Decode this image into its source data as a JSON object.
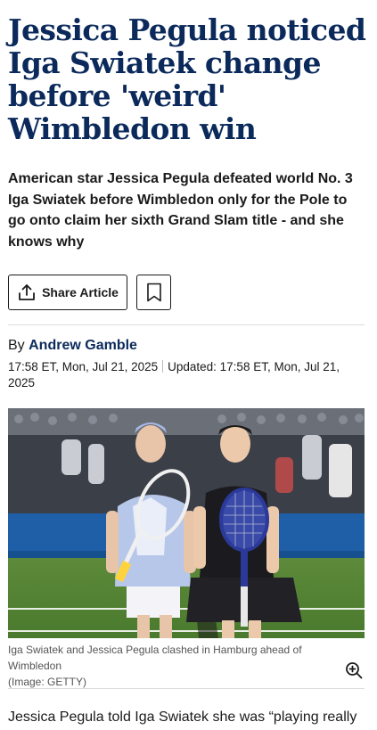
{
  "article": {
    "headline": "Jessica Pegula noticed Iga Swiatek change before 'weird' Wimbledon win",
    "standfirst": "American star Jessica Pegula defeated world No. 3 Iga Swiatek before Wimbledon only for the Pole to go onto claim her sixth Grand Slam title - and she knows why",
    "share_label": "Share Article",
    "byline_prefix": "By",
    "author": "Andrew Gamble",
    "published": "17:58 ET, Mon, Jul 21, 2025",
    "updated": "Updated: 17:58 ET, Mon, Jul 21, 2025",
    "image_caption": "Iga Swiatek and Jessica Pegula clashed in Hamburg ahead of Wimbledon",
    "image_credit": "(Image: GETTY)",
    "body_first": "Jessica Pegula told Iga Swiatek she was “playing really good on grass” before the Pole’s"
  },
  "icons": {
    "share": "share-icon",
    "bookmark": "bookmark-icon",
    "zoom": "zoom-in-icon"
  },
  "colors": {
    "headline": "#0b2a5b",
    "author": "#0b2a5b"
  }
}
